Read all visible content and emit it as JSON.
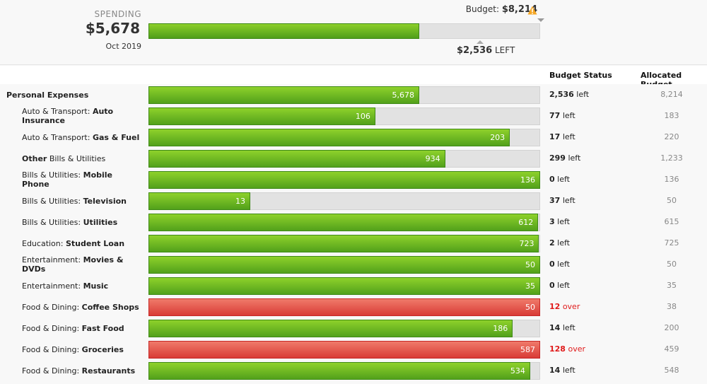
{
  "summary": {
    "spending_label": "SPENDING",
    "spending_amount": "$5,678",
    "period": "Oct 2019",
    "budget_label": "Budget:",
    "budget_amount": "$8,214",
    "left_amount": "$2,536",
    "left_label": "LEFT",
    "progress_fraction": 0.691,
    "warning_icon": "warning-triangle-icon"
  },
  "columns": {
    "status": "Budget Status",
    "allocated": "Allocated Budget"
  },
  "colors": {
    "under": "#6ab823",
    "over": "#e04a40",
    "over_text": "#e01b1b",
    "warning": "#f5a623"
  },
  "rows": [
    {
      "prefix": "",
      "name": "Personal Expenses",
      "total": true,
      "spent": 5678,
      "spent_label": "5,678",
      "status_value": "2,536",
      "status_word": "left",
      "over": false,
      "allocated": 8214,
      "allocated_label": "8,214"
    },
    {
      "prefix": "Auto & Transport: ",
      "name": "Auto Insurance",
      "spent": 106,
      "spent_label": "106",
      "status_value": "77",
      "status_word": "left",
      "over": false,
      "allocated": 183,
      "allocated_label": "183"
    },
    {
      "prefix": "Auto & Transport: ",
      "name": "Gas & Fuel",
      "spent": 203,
      "spent_label": "203",
      "status_value": "17",
      "status_word": "left",
      "over": false,
      "allocated": 220,
      "allocated_label": "220"
    },
    {
      "prefix": "",
      "name": "Other",
      "suffix": " Bills & Utilities",
      "spent": 934,
      "spent_label": "934",
      "status_value": "299",
      "status_word": "left",
      "over": false,
      "allocated": 1233,
      "allocated_label": "1,233"
    },
    {
      "prefix": "Bills & Utilities: ",
      "name": "Mobile Phone",
      "spent": 136,
      "spent_label": "136",
      "status_value": "0",
      "status_word": "left",
      "over": false,
      "allocated": 136,
      "allocated_label": "136"
    },
    {
      "prefix": "Bills & Utilities: ",
      "name": "Television",
      "spent": 13,
      "spent_label": "13",
      "status_value": "37",
      "status_word": "left",
      "over": false,
      "allocated": 50,
      "allocated_label": "50"
    },
    {
      "prefix": "Bills & Utilities: ",
      "name": "Utilities",
      "spent": 612,
      "spent_label": "612",
      "status_value": "3",
      "status_word": "left",
      "over": false,
      "allocated": 615,
      "allocated_label": "615"
    },
    {
      "prefix": "Education: ",
      "name": "Student Loan",
      "spent": 723,
      "spent_label": "723",
      "status_value": "2",
      "status_word": "left",
      "over": false,
      "allocated": 725,
      "allocated_label": "725"
    },
    {
      "prefix": "Entertainment: ",
      "name": "Movies & DVDs",
      "spent": 50,
      "spent_label": "50",
      "status_value": "0",
      "status_word": "left",
      "over": false,
      "allocated": 50,
      "allocated_label": "50"
    },
    {
      "prefix": "Entertainment: ",
      "name": "Music",
      "spent": 35,
      "spent_label": "35",
      "status_value": "0",
      "status_word": "left",
      "over": false,
      "allocated": 35,
      "allocated_label": "35"
    },
    {
      "prefix": "Food & Dining: ",
      "name": "Coffee Shops",
      "spent": 50,
      "spent_label": "50",
      "status_value": "12",
      "status_word": "over",
      "over": true,
      "allocated": 38,
      "allocated_label": "38"
    },
    {
      "prefix": "Food & Dining: ",
      "name": "Fast Food",
      "spent": 186,
      "spent_label": "186",
      "status_value": "14",
      "status_word": "left",
      "over": false,
      "allocated": 200,
      "allocated_label": "200"
    },
    {
      "prefix": "Food & Dining: ",
      "name": "Groceries",
      "spent": 587,
      "spent_label": "587",
      "status_value": "128",
      "status_word": "over",
      "over": true,
      "allocated": 459,
      "allocated_label": "459"
    },
    {
      "prefix": "Food & Dining: ",
      "name": "Restaurants",
      "spent": 534,
      "spent_label": "534",
      "status_value": "14",
      "status_word": "left",
      "over": false,
      "allocated": 548,
      "allocated_label": "548"
    }
  ]
}
